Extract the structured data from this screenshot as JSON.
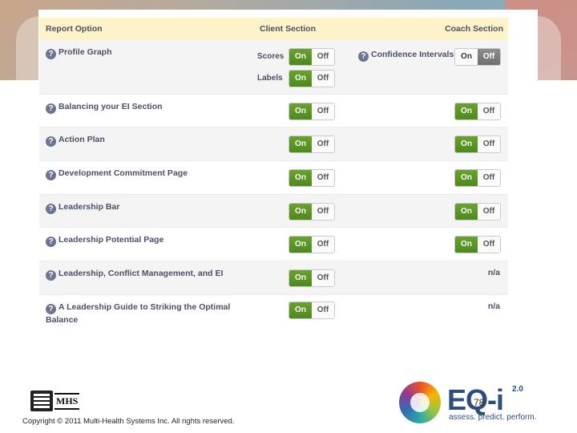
{
  "header": {
    "report_option": "Report Option",
    "client_section": "Client Section",
    "coach_section": "Coach Section"
  },
  "toggle": {
    "on": "On",
    "off": "Off"
  },
  "rows": [
    {
      "label": "Profile Graph",
      "scores_label": "Scores",
      "labels_label": "Labels",
      "client_scores": "on",
      "client_labels": "on",
      "coach_label": "Confidence Intervals",
      "coach": "off"
    },
    {
      "label": "Balancing your EI Section",
      "client": "on",
      "coach": "on"
    },
    {
      "label": "Action Plan",
      "client": "on",
      "coach": "on"
    },
    {
      "label": "Development Commitment Page",
      "client": "on",
      "coach": "on"
    },
    {
      "label": "Leadership Bar",
      "client": "on",
      "coach": "on"
    },
    {
      "label": "Leadership Potential Page",
      "client": "on",
      "coach": "on"
    },
    {
      "label": "Leadership, Conflict Management, and EI",
      "client": "on",
      "coach_text": "n/a"
    },
    {
      "label": "A Leadership Guide to Striking the Optimal Balance",
      "client": "on",
      "coach_text": "n/a"
    }
  ],
  "footer": {
    "mhs_logo_text": "MHS",
    "copyright": "Copyright © 2011 Multi-Health Systems Inc. All rights reserved.",
    "page_number": "78",
    "eq_logo_text": "EQ-i",
    "eq_logo_version": "2.0",
    "eq_tagline": "assess. predict. perform."
  },
  "colors": {
    "header_bg": "#fdf2c8",
    "on_active": "#5a9624",
    "off_active": "#7e7e7e",
    "text": "#4b4f66"
  },
  "icons": {
    "help": "question-circle-icon"
  }
}
